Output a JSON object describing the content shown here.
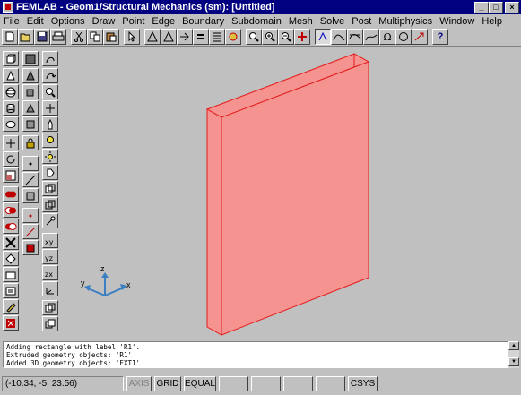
{
  "window": {
    "title": "FEMLAB - Geom1/Structural Mechanics (sm): [Untitled]",
    "minimize_glyph": "_",
    "maximize_glyph": "□",
    "close_glyph": "×"
  },
  "menu": [
    "File",
    "Edit",
    "Options",
    "Draw",
    "Point",
    "Edge",
    "Boundary",
    "Subdomain",
    "Mesh",
    "Solve",
    "Post",
    "Multiphysics",
    "Window",
    "Help"
  ],
  "toolbar": {
    "icons": [
      "new-icon",
      "open-icon",
      "save-icon",
      "print-icon",
      "cut-icon",
      "copy-icon",
      "paste-icon",
      "select-arrow-icon",
      "triangle-mode-icon",
      "boundary-mode-icon",
      "subdomain-mode-icon",
      "equal-icon",
      "list-icon",
      "settings-icon",
      "zoom-window-icon",
      "zoom-in-icon",
      "zoom-out-icon",
      "zoom-extents-icon",
      "solve-icon",
      "plot-icon",
      "multiphysics-icon",
      "model-icon",
      "omega-icon",
      "circle-icon",
      "arrow-icon",
      "help-icon"
    ]
  },
  "axes": {
    "x_label": "x",
    "y_label": "y",
    "z_label": "z"
  },
  "console": {
    "lines": [
      "Adding rectangle with label 'R1'.",
      "Extruded geometry objects: 'R1'",
      "Added 3D geometry objects: 'EXT1'"
    ]
  },
  "status": {
    "coords": "(-10.34, -5, 23.56)",
    "axis": "AXIS",
    "grid": "GRID",
    "equal": "EQUAL",
    "csys": "CSYS"
  },
  "colors": {
    "title_bar": "#000080",
    "solid_fill": "#f4938f",
    "solid_edge": "#e41c1c",
    "axis_triad": "#3a7fc2"
  }
}
